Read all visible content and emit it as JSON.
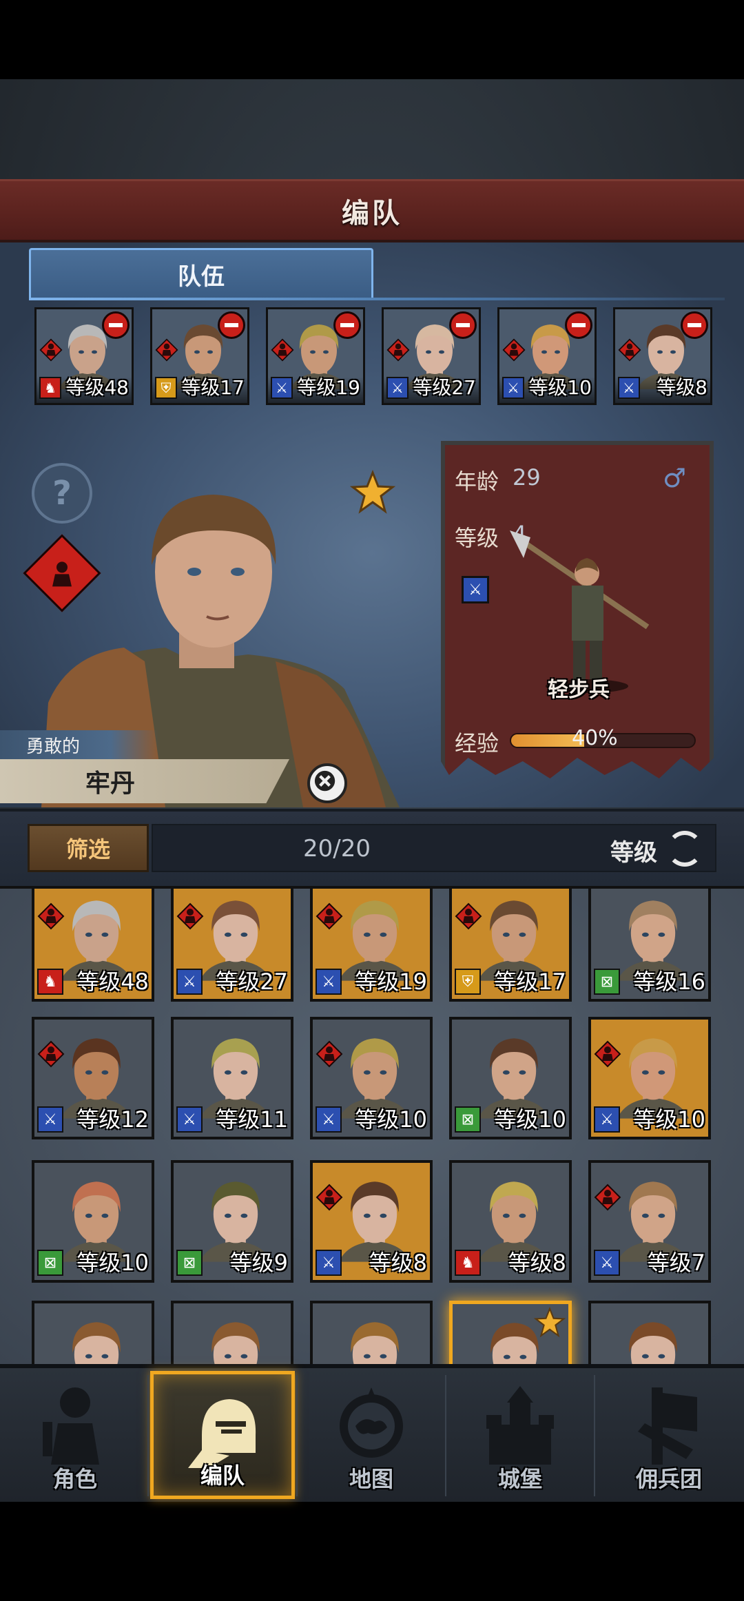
{
  "header": {
    "title": "编队"
  },
  "team": {
    "tab_label": "队伍",
    "members": [
      {
        "level": "等级48",
        "class": "horse",
        "bg": "#4b5a6c",
        "hair": "#b8b8b8",
        "skin": "#c9a28a",
        "flag": true
      },
      {
        "level": "等级17",
        "class": "shield",
        "bg": "#4b5a6c",
        "hair": "#6a4a32",
        "skin": "#c89878"
      },
      {
        "level": "等级19",
        "class": "sword",
        "bg": "#4b5a6c",
        "hair": "#b09a48",
        "skin": "#c89878"
      },
      {
        "level": "等级27",
        "class": "sword",
        "bg": "#4b5a6c",
        "hair": "#d6b8a0",
        "skin": "#d8b4a0"
      },
      {
        "level": "等级10",
        "class": "sword",
        "bg": "#4b5a6c",
        "hair": "#c89a48",
        "skin": "#d09878"
      },
      {
        "level": "等级8",
        "class": "sword",
        "bg": "#4b5a6c",
        "hair": "#5a3a28",
        "skin": "#d8b4a0"
      }
    ]
  },
  "hero": {
    "trait": "勇敢的",
    "name": "牢丹",
    "age_label": "年龄",
    "age_value": "29",
    "level_label": "等级",
    "level_value": "4",
    "unit_name": "轻步兵",
    "exp_label": "经验",
    "exp_percent_text": "40%",
    "exp_fraction": 0.4,
    "gender": "♂"
  },
  "filter": {
    "button_label": "筛选",
    "count": "20/20",
    "sort_label": "等级"
  },
  "roster": [
    {
      "level": "等级48",
      "class": "horse",
      "bg": "#c88a2a",
      "hair": "#b8b8b8",
      "skin": "#c9a28a",
      "role": true
    },
    {
      "level": "等级27",
      "class": "sword",
      "bg": "#c88a2a",
      "hair": "#7a5038",
      "skin": "#d8b4a0",
      "role": true
    },
    {
      "level": "等级19",
      "class": "sword",
      "bg": "#c88a2a",
      "hair": "#b09a48",
      "skin": "#c89878",
      "role": true
    },
    {
      "level": "等级17",
      "class": "shield",
      "bg": "#c88a2a",
      "hair": "#6a4a32",
      "skin": "#c89878",
      "role": true
    },
    {
      "level": "等级16",
      "class": "bow",
      "bg": "#4a525c",
      "hair": "#a08060",
      "skin": "#d0a488"
    },
    {
      "level": "等级12",
      "class": "sword",
      "bg": "#4a525c",
      "hair": "#5a3420",
      "skin": "#b88058",
      "role": true
    },
    {
      "level": "等级11",
      "class": "sword",
      "bg": "#4a525c",
      "hair": "#a8a050",
      "skin": "#d8b4a0"
    },
    {
      "level": "等级10",
      "class": "sword",
      "bg": "#4a525c",
      "hair": "#b09a48",
      "skin": "#c89878",
      "role": true
    },
    {
      "level": "等级10",
      "class": "bow",
      "bg": "#4a525c",
      "hair": "#5a3a28",
      "skin": "#d0a488"
    },
    {
      "level": "等级10",
      "class": "sword",
      "bg": "#c88a2a",
      "hair": "#c89a48",
      "skin": "#d09878",
      "role": true
    },
    {
      "level": "等级10",
      "class": "bow",
      "bg": "#4a525c",
      "hair": "#c07050",
      "skin": "#c89878"
    },
    {
      "level": "等级9",
      "class": "bow",
      "bg": "#4a525c",
      "hair": "#5a5a30",
      "skin": "#d8b4a0"
    },
    {
      "level": "等级8",
      "class": "sword",
      "bg": "#c88a2a",
      "hair": "#5a3a28",
      "skin": "#d8b4a0",
      "role": true
    },
    {
      "level": "等级8",
      "class": "horse",
      "bg": "#4a525c",
      "hair": "#c0a850",
      "skin": "#c89878"
    },
    {
      "level": "等级7",
      "class": "sword",
      "bg": "#4a525c",
      "hair": "#a07850",
      "skin": "#d0a488",
      "role": true
    },
    {
      "level": "",
      "class": "",
      "bg": "#4a525c",
      "hair": "#8a5a30",
      "skin": "#d8b4a0"
    },
    {
      "level": "",
      "class": "",
      "bg": "#4a525c",
      "hair": "#8a5a30",
      "skin": "#d8b4a0"
    },
    {
      "level": "",
      "class": "",
      "bg": "#4a525c",
      "hair": "#9a6a30",
      "skin": "#d8b4a0"
    },
    {
      "level": "",
      "class": "",
      "bg": "#4a525c",
      "hair": "#7a4a28",
      "skin": "#d8b4a0",
      "selected": true,
      "starred": true
    },
    {
      "level": "",
      "class": "",
      "bg": "#4a525c",
      "hair": "#7a4a28",
      "skin": "#d8b4a0"
    }
  ],
  "nav": [
    {
      "label": "角色",
      "icon": "knight-icon"
    },
    {
      "label": "编队",
      "icon": "helmet-icon",
      "active": true
    },
    {
      "label": "地图",
      "icon": "compass-map-icon"
    },
    {
      "label": "城堡",
      "icon": "castle-icon"
    },
    {
      "label": "佣兵团",
      "icon": "banner-icon"
    }
  ],
  "colors": {
    "accent_gold": "#f0a820",
    "banner_red": "#5c2624",
    "team_blue": "#4b6f98",
    "class_sword": "#2c4fb0",
    "class_shield": "#d69a1a",
    "class_horse": "#c8201a",
    "class_bow": "#3a9a3a"
  }
}
